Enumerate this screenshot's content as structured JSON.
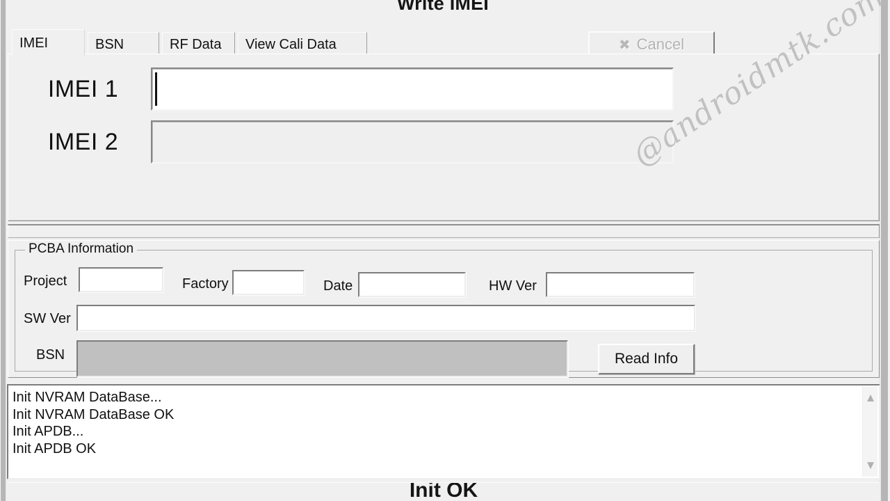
{
  "window": {
    "title": "Write IMEI"
  },
  "toolbar": {
    "cancel_label": "Cancel",
    "cancel_icon": "x-cross-icon",
    "cancel_disabled": true
  },
  "tabs": [
    {
      "label": "IMEI",
      "active": true
    },
    {
      "label": "BSN",
      "active": false
    },
    {
      "label": "RF Data",
      "active": false
    },
    {
      "label": "View Cali Data",
      "active": false
    }
  ],
  "imei_panel": {
    "rows": [
      {
        "label": "IMEI 1",
        "value": "",
        "enabled": true,
        "focused": true
      },
      {
        "label": "IMEI 2",
        "value": "",
        "enabled": false,
        "focused": false
      }
    ]
  },
  "pcba": {
    "group_title": "PCBA Information",
    "fields": [
      {
        "label": "Project",
        "value": "",
        "enabled": true
      },
      {
        "label": "Factory",
        "value": "",
        "enabled": true
      },
      {
        "label": "Date",
        "value": "",
        "enabled": true
      },
      {
        "label": "HW Ver",
        "value": "",
        "enabled": true
      },
      {
        "label": "SW Ver",
        "value": "",
        "enabled": true
      },
      {
        "label": "BSN",
        "value": "",
        "enabled": false
      }
    ],
    "read_info_label": "Read Info"
  },
  "log": {
    "lines": [
      "Init NVRAM DataBase...",
      "Init NVRAM DataBase OK",
      "Init APDB...",
      "Init APDB OK"
    ],
    "scrollbar": {
      "up_icon": "chevron-up-icon",
      "down_icon": "chevron-down-icon"
    }
  },
  "status": {
    "text": "Init OK"
  },
  "watermark": {
    "text": "@androidmtk.com"
  },
  "colors": {
    "window_bg": "#f0f0f0",
    "field_bg": "#ffffff",
    "disabled_field_bg": "#efefef",
    "grey_field_bg": "#c0c0c0",
    "text": "#101010",
    "disabled_text": "#b3b3b3",
    "border": "#8e8e8e"
  }
}
